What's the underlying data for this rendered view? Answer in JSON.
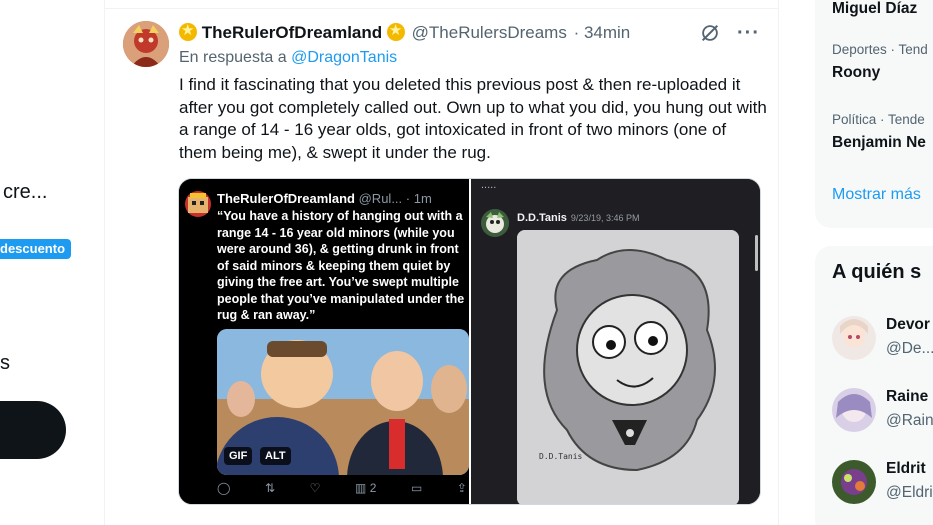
{
  "left_sidebar": {
    "truncated_text": "cre...",
    "badge": "descuento",
    "truncated_label": "s"
  },
  "tweet": {
    "display_name": "TheRulerOfDreamland",
    "handle": "@TheRulersDreams",
    "time": "· 34min",
    "reply_prefix": "En respuesta a",
    "reply_mention": "@DragonTanis",
    "text": "I find it fascinating that you deleted this previous post & then re-uploaded it after you got completely called out. Own up to what you did, you hung out with a range of 14 - 16 year olds, got intoxicated in front of two minors (one of them being me), & swept it under the rug.",
    "media_left": {
      "name": "TheRulerOfDreamland",
      "handle": "@Rul...",
      "time": "· 1m",
      "quote": "“You have a history of hanging out with a range 14 - 16 year old minors (while you were around 36), & getting drunk in front of said minors & keeping them quiet by giving the free art. You’ve swept multiple people that you’ve manipulated under the rug & ran away.”",
      "gif_label": "GIF",
      "alt_label": "ALT",
      "views_count": "2"
    },
    "media_right": {
      "top_text": ".....",
      "author": "D.D.Tanis",
      "timestamp": "9/23/19, 3:46 PM",
      "sketch_signature": "D.D.Tanis"
    }
  },
  "right_sidebar": {
    "trends": [
      {
        "category": "",
        "name": "Miguel Díaz"
      },
      {
        "category": "Deportes · Tend",
        "name": "Roony"
      },
      {
        "category": "Política · Tende",
        "name": "Benjamin Ne"
      }
    ],
    "show_more": "Mostrar más",
    "who_to_follow_title": "A quién s",
    "suggestions": [
      {
        "name": "Devor",
        "handle": "@De..."
      },
      {
        "name": "Raine",
        "handle": "@Rain"
      },
      {
        "name": "Eldrit",
        "handle": "@Eldri"
      }
    ]
  },
  "colors": {
    "accent": "#1d9bf0",
    "text_primary": "#0f1419",
    "text_secondary": "#536471",
    "discord_bg": "#1f1f23"
  }
}
